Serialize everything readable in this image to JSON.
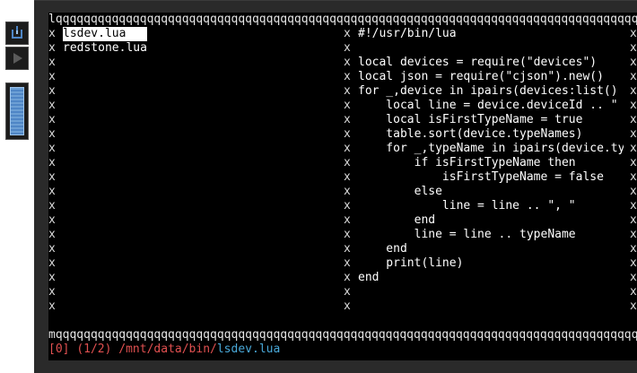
{
  "toolbar": {
    "power_icon": "power-icon",
    "play_icon": "play-icon",
    "scrollbar_color": "#5b8fcc"
  },
  "terminal": {
    "top_border": "lqqqqqqqqqqqqqqqqqqqqqqqqqqqqqqqqqqqqqqqqqqqqqqqqqqqqqqqqqqqqqqqqqqqqqqqqqqqqqqqqqqqqqqqqqqqqqqk",
    "bottom_border": "mqqqqqqqqqqqqqqqqqqqqqqqqqqqqqqqqqqqqqqqqqqqqqqqqqqqqqqqqqqqqqqqqqqqqqqqqqqqqqqqqqqqqqqqqqqqqqqqj",
    "side_char": "x",
    "files": [
      "lsdev.lua",
      "redstone.lua"
    ],
    "selected_file": "lsdev.lua",
    "code_lines": [
      "#!/usr/bin/lua",
      "",
      "local devices = require(\"devices\")",
      "local json = require(\"cjson\").new()",
      "for _,device in ipairs(devices:list()",
      "    local line = device.deviceId .. \"",
      "    local isFirstTypeName = true",
      "    table.sort(device.typeNames)",
      "    for _,typeName in ipairs(device.ty",
      "        if isFirstTypeName then",
      "            isFirstTypeName = false",
      "        else",
      "            line = line .. \", \"",
      "        end",
      "        line = line .. typeName",
      "    end",
      "    print(line)",
      "end"
    ],
    "status": {
      "index": "[0]",
      "count": "(1/2)",
      "dir": "/mnt/data/bin/",
      "file": "lsdev.lua"
    },
    "colors": {
      "background": "#000000",
      "text": "#ffffff",
      "status_red": "#e05050",
      "status_cyan": "#49a8d8"
    }
  }
}
